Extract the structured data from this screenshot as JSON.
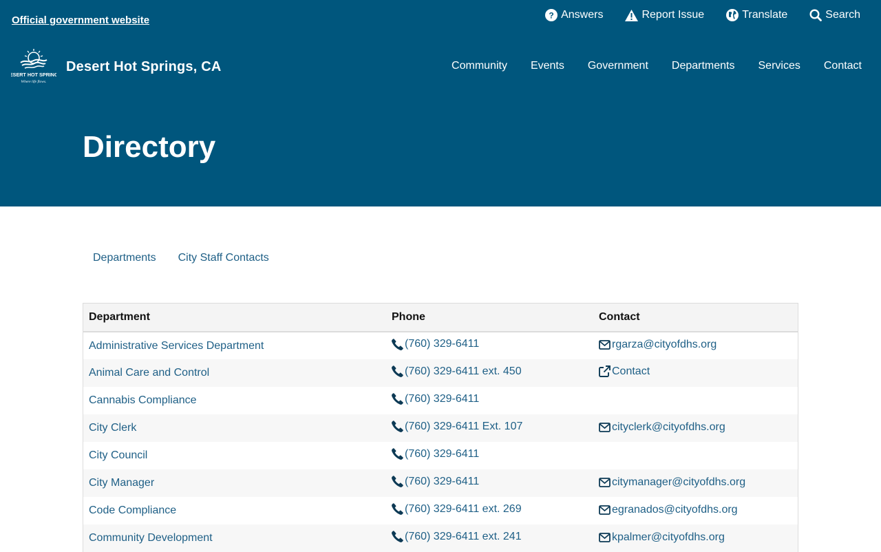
{
  "header": {
    "official_label": "Official government website",
    "utility": [
      {
        "label": "Answers",
        "icon": "question-circle-icon"
      },
      {
        "label": "Report Issue",
        "icon": "warning-icon"
      },
      {
        "label": "Translate",
        "icon": "globe-icon"
      },
      {
        "label": "Search",
        "icon": "search-icon"
      }
    ],
    "site_name": "Desert Hot Springs, CA",
    "logo": {
      "text_main": "DESERT HOT SPRINGS",
      "text_tag": "Where life flows."
    },
    "nav": [
      "Community",
      "Events",
      "Government",
      "Departments",
      "Services",
      "Contact"
    ]
  },
  "page": {
    "title": "Directory"
  },
  "tabs": [
    "Departments",
    "City Staff Contacts"
  ],
  "table": {
    "columns": [
      "Department",
      "Phone",
      "Contact"
    ],
    "rows": [
      {
        "department": "Administrative Services Department",
        "phone": "(760) 329-6411",
        "contact": "rgarza@cityofdhs.org",
        "contact_type": "email"
      },
      {
        "department": "Animal Care and Control",
        "phone": "(760) 329-6411 ext. 450",
        "contact": "Contact",
        "contact_type": "external"
      },
      {
        "department": "Cannabis Compliance",
        "phone": "(760) 329-6411",
        "contact": "",
        "contact_type": "none"
      },
      {
        "department": "City Clerk",
        "phone": "(760) 329-6411 Ext. 107",
        "contact": "cityclerk@cityofdhs.org",
        "contact_type": "email"
      },
      {
        "department": "City Council",
        "phone": "(760) 329-6411",
        "contact": "",
        "contact_type": "none"
      },
      {
        "department": "City Manager",
        "phone": "(760) 329-6411",
        "contact": "citymanager@cityofdhs.org",
        "contact_type": "email"
      },
      {
        "department": "Code Compliance",
        "phone": "(760) 329-6411 ext. 269",
        "contact": "egranados@cityofdhs.org",
        "contact_type": "email"
      },
      {
        "department": "Community Development",
        "phone": "(760) 329-6411 ext. 241",
        "contact": "kpalmer@cityofdhs.org",
        "contact_type": "email"
      }
    ]
  },
  "colors": {
    "brand": "#00567d",
    "link": "#1e5f86",
    "header_row": "#f4f4f4",
    "stripe_row": "#f7f7f7"
  }
}
